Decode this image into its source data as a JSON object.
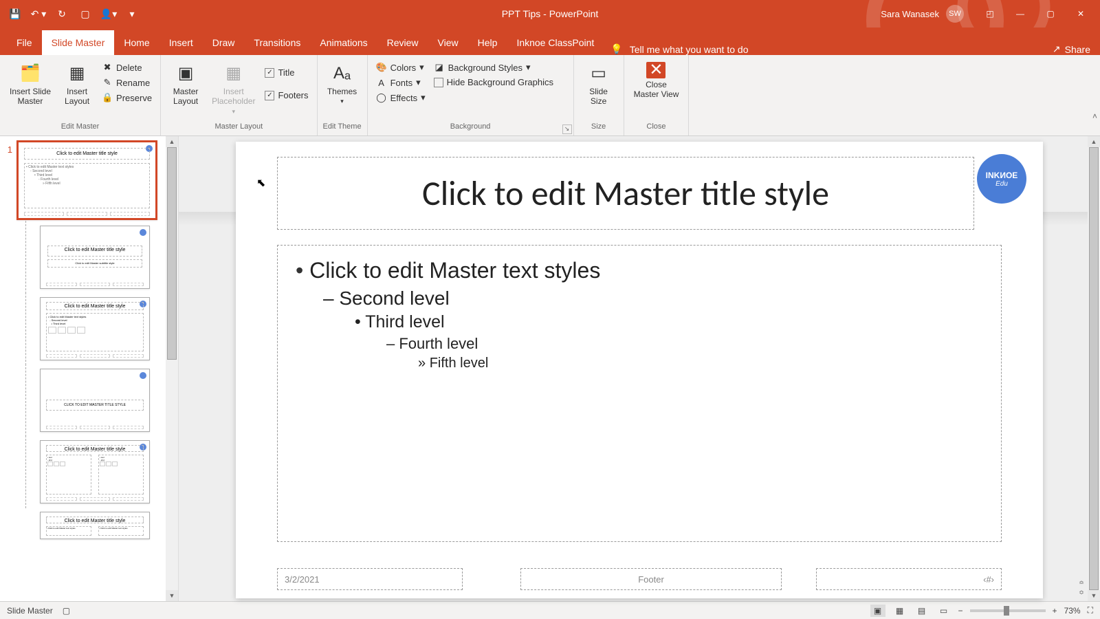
{
  "titlebar": {
    "doc_title": "PPT Tips  -  PowerPoint",
    "user_name": "Sara Wanasek",
    "user_initials": "SW"
  },
  "tabs": {
    "file": "File",
    "slide_master": "Slide Master",
    "home": "Home",
    "insert": "Insert",
    "draw": "Draw",
    "transitions": "Transitions",
    "animations": "Animations",
    "review": "Review",
    "view": "View",
    "help": "Help",
    "inknoe": "Inknoe ClassPoint",
    "tell_me": "Tell me what you want to do",
    "share": "Share"
  },
  "ribbon": {
    "insert_slide_master": "Insert Slide\nMaster",
    "insert_layout": "Insert\nLayout",
    "delete": "Delete",
    "rename": "Rename",
    "preserve": "Preserve",
    "edit_master_group": "Edit Master",
    "master_layout": "Master\nLayout",
    "insert_placeholder": "Insert\nPlaceholder",
    "title_chk": "Title",
    "footers_chk": "Footers",
    "master_layout_group": "Master Layout",
    "themes": "Themes",
    "edit_theme_group": "Edit Theme",
    "colors": "Colors",
    "fonts": "Fonts",
    "effects": "Effects",
    "bg_styles": "Background Styles",
    "hide_bg": "Hide Background Graphics",
    "background_group": "Background",
    "slide_size": "Slide\nSize",
    "size_group": "Size",
    "close_master": "Close\nMaster View",
    "close_group": "Close"
  },
  "thumbnails": {
    "index": "1",
    "master_title": "Click to edit Master title style",
    "master_l1": "Click to edit Master text styles",
    "master_l2": "Second level",
    "master_l3": "Third level",
    "master_l4": "Fourth level",
    "master_l5": "Fifth level",
    "layout_title_small": "Click to edit Master title style",
    "section_title": "CLICK TO EDIT MASTER TITLE STYLE"
  },
  "slide": {
    "title": "Click to edit Master title style",
    "l1": "Click to edit Master text styles",
    "l2": "Second level",
    "l3": "Third level",
    "l4": "Fourth level",
    "l5": "Fifth level",
    "date": "3/2/2021",
    "footer": "Footer",
    "slide_num": "‹#›",
    "logo_top": "INKИOE",
    "logo_sub": "Edu"
  },
  "status": {
    "mode": "Slide Master",
    "zoom": "73%"
  }
}
